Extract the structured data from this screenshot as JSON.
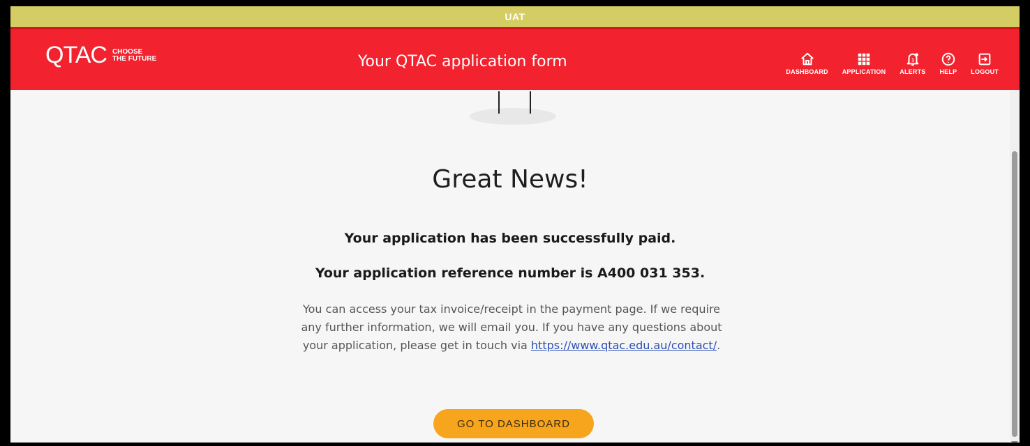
{
  "env_banner": "UAT",
  "header": {
    "logo_main": "QTAC",
    "logo_tag_line1": "CHOOSE",
    "logo_tag_line2": "THE FUTURE",
    "title": "Your QTAC application form"
  },
  "nav": [
    {
      "label": "DASHBOARD",
      "icon": "home-icon"
    },
    {
      "label": "APPLICATION",
      "icon": "grid-icon"
    },
    {
      "label": "ALERTS",
      "icon": "bell-icon"
    },
    {
      "label": "HELP",
      "icon": "help-icon"
    },
    {
      "label": "LOGOUT",
      "icon": "logout-icon"
    }
  ],
  "main": {
    "heading": "Great News!",
    "paid_message": "Your application has been successfully paid.",
    "reference_message": "Your application reference number is A400 031 353.",
    "info_text": "You can access your tax invoice/receipt in the payment page. If we require any further information, we will email you. If you have any questions about your application, please get in touch via ",
    "contact_link": "https://www.qtac.edu.au/contact/",
    "info_end": ".",
    "button_label": "GO TO DASHBOARD"
  },
  "colors": {
    "env_bar": "#d4cd63",
    "header": "#f2232f",
    "button": "#f7a51c",
    "link": "#2a4fb5"
  }
}
